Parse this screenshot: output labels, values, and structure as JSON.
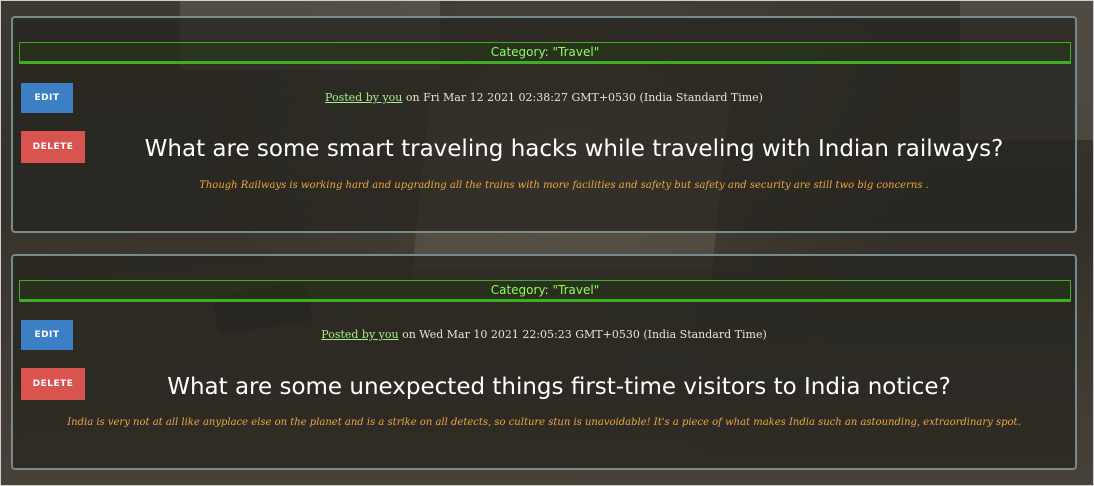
{
  "posts": [
    {
      "category": "Category: \"Travel\"",
      "edit_label": "EDIT",
      "delete_label": "DELETE",
      "posted_by": "Posted by you",
      "posted_on": " on Fri Mar 12 2021 02:38:27 GMT+0530 (India Standard Time)",
      "title": "What are some smart traveling hacks while traveling with Indian railways?",
      "description": "Though Railways is working hard and upgrading all the trains with more facilities and safety but safety and security are still two big concerns ."
    },
    {
      "category": "Category: \"Travel\"",
      "edit_label": "EDIT",
      "delete_label": "DELETE",
      "posted_by": "Posted by you",
      "posted_on": " on Wed Mar 10 2021 22:05:23 GMT+0530 (India Standard Time)",
      "title": "What are some unexpected things first-time visitors to India notice?",
      "description": "India is very not at all like anyplace else on the planet and is a strike on all detects, so culture stun is unavoidable! It's a piece of what makes India such an astounding, extraordinary spot."
    }
  ],
  "colors": {
    "category_text": "#8cff5c",
    "category_border": "#3fae22",
    "edit_button": "#3c7fc4",
    "delete_button": "#d9534f",
    "author_link": "#a6f08a",
    "description_text": "#f0a640",
    "title_text": "#ffffff"
  }
}
